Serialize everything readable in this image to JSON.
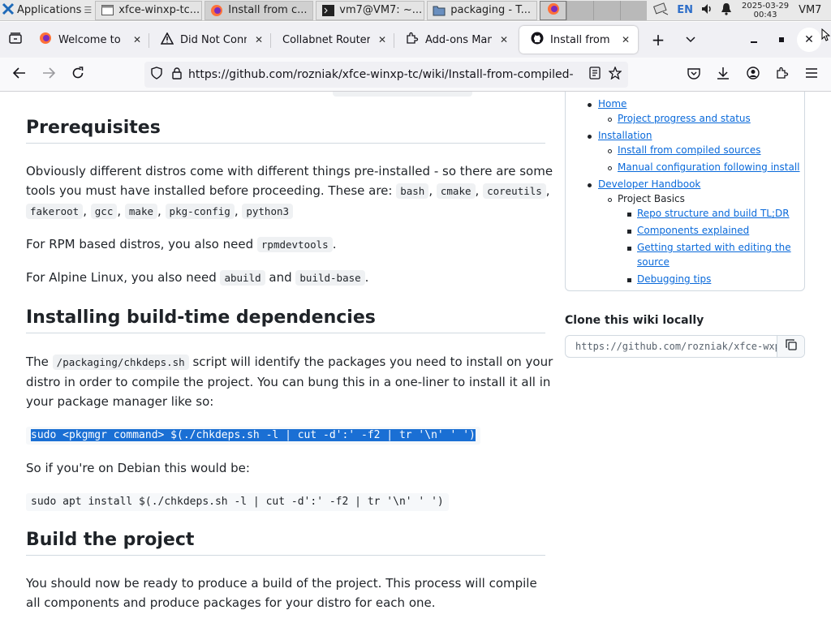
{
  "taskbar": {
    "apps_label": "Applications",
    "tasks": [
      {
        "label": "xfce-winxp-tc..."
      },
      {
        "label": "Install from c..."
      },
      {
        "label": "vm7@VM7: ~..."
      },
      {
        "label": "packaging - T..."
      }
    ],
    "lang": "EN",
    "date": "2025-03-29",
    "time": "00:43",
    "user": "VM7"
  },
  "tabs": [
    {
      "label": "Welcome to Fi"
    },
    {
      "label": "Did Not Conne"
    },
    {
      "label": "Collabnet Router"
    },
    {
      "label": "Add-ons Mana"
    },
    {
      "label": "Install from co"
    }
  ],
  "navbar": {
    "url": "https://github.com/rozniak/xfce-winxp-tc/wiki/Install-from-compiled-"
  },
  "article": {
    "h_prereq": "Prerequisites",
    "p1_a": "Obviously different distros come with different things pre-installed - so there are some tools you must have installed before proceeding. These are: ",
    "pkgs": [
      "bash",
      "cmake",
      "coreutils",
      "fakeroot",
      "gcc",
      "make",
      "pkg-config",
      "python3"
    ],
    "p2_a": "For RPM based distros, you also need ",
    "p2_code": "rpmdevtools",
    "p3_a": "For Alpine Linux, you also need ",
    "p3_code1": "abuild",
    "p3_and": " and ",
    "p3_code2": "build-base",
    "h_deps": "Installing build-time dependencies",
    "p4_a": "The ",
    "p4_code": "/packaging/chkdeps.sh",
    "p4_b": " script will identify the packages you need to install on your distro in order to compile the project. You can bung this in a one-liner to install it all in your package manager like so:",
    "code1": "sudo <pkgmgr command> $(./chkdeps.sh -l | cut -d':' -f2 | tr '\\n' ' ')",
    "p5": "So if you're on Debian this would be:",
    "code2": "sudo apt install $(./chkdeps.sh -l | cut -d':' -f2 | tr '\\n' ' ')",
    "h_build": "Build the project",
    "p6": "You should now be ready to produce a build of the project. This process will compile all components and produce packages for your distro for each one."
  },
  "toc": {
    "home": "Home",
    "progress": "Project progress and status",
    "installation": "Installation",
    "install_compiled": "Install from compiled sources",
    "manual_config": "Manual configuration following install",
    "dev_handbook": "Developer Handbook",
    "project_basics": "Project Basics",
    "repo_structure": "Repo structure and build TL;DR",
    "components": "Components explained",
    "getting_started_1": "Getting started with editing the",
    "getting_started_2": "source",
    "debugging": "Debugging tips"
  },
  "clone": {
    "title": "Clone this wiki locally",
    "url": "https://github.com/rozniak/xfce-wxp-tc.wiki.git"
  },
  "colors": {
    "link": "#0969da",
    "selection": "#1a6fd4"
  }
}
